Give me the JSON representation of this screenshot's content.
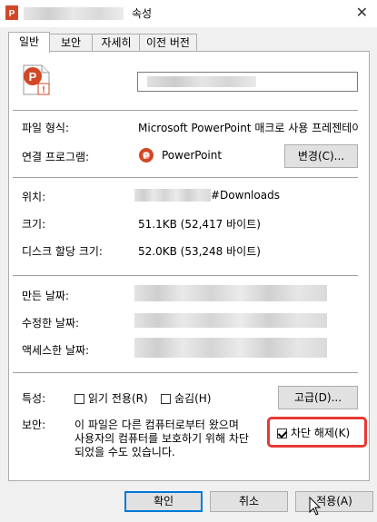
{
  "window": {
    "title": "속성",
    "close_glyph": "✕",
    "app_icon": "powerpoint-icon"
  },
  "tabs": [
    "일반",
    "보안",
    "자세히",
    "이전 버전"
  ],
  "general": {
    "file_icon": "powerpoint-file-icon",
    "file_type_label": "파일 형식:",
    "file_type_value": "Microsoft PowerPoint 매크로 사용 프레젠테이",
    "opens_with_label": "연결 프로그램:",
    "opens_with_value": "PowerPoint",
    "change_button": "변경(C)...",
    "location_label": "위치:",
    "location_value": "#Downloads",
    "size_label": "크기:",
    "size_value": "51.1KB (52,417 바이트)",
    "size_on_disk_label": "디스크 할당 크기:",
    "size_on_disk_value": "52.0KB (53,248 바이트)",
    "created_label": "만든 날짜:",
    "modified_label": "수정한 날짜:",
    "accessed_label": "액세스한 날짜:",
    "attributes_label": "특성:",
    "readonly_label": "읽기 전용(R)",
    "hidden_label": "숨김(H)",
    "advanced_button": "고급(D)...",
    "security_label": "보안:",
    "security_text_1": "이 파일은 다른 컴퓨터로부터 왔으며",
    "security_text_2": "사용자의 컴퓨터를 보호하기 위해 차단",
    "security_text_3": "되었을 수도 있습니다.",
    "unblock_label": "차단 해제(K)",
    "unblock_checked": true,
    "readonly_checked": false,
    "hidden_checked": false
  },
  "footer": {
    "ok_button": "확인",
    "cancel_button": "취소",
    "apply_button": "적용(A)"
  },
  "colors": {
    "highlight": "#e53935",
    "powerpoint": "#d24726",
    "focus": "#0078d7"
  }
}
